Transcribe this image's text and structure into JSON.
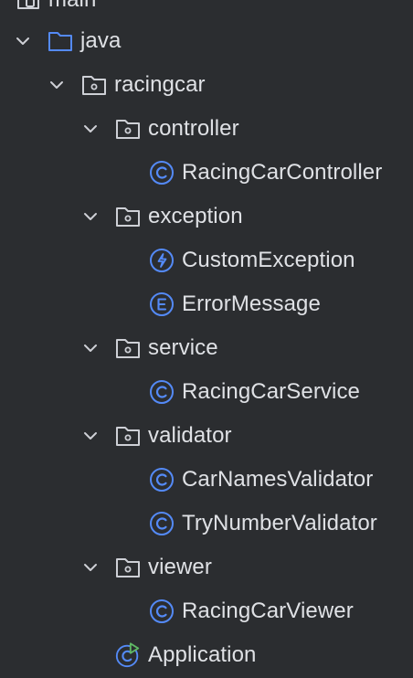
{
  "tree": {
    "rows": [
      {
        "label": "main"
      },
      {
        "label": "java"
      },
      {
        "label": "racingcar"
      },
      {
        "label": "controller"
      },
      {
        "label": "RacingCarController"
      },
      {
        "label": "exception"
      },
      {
        "label": "CustomException"
      },
      {
        "label": "ErrorMessage"
      },
      {
        "label": "service"
      },
      {
        "label": "RacingCarService"
      },
      {
        "label": "validator"
      },
      {
        "label": "CarNamesValidator"
      },
      {
        "label": "TryNumberValidator"
      },
      {
        "label": "viewer"
      },
      {
        "label": "RacingCarViewer"
      },
      {
        "label": "Application"
      }
    ]
  },
  "colors": {
    "background": "#2b2d30",
    "text": "#dfe1e5",
    "folder_blue": "#548af7",
    "package_gray": "#ced0d6",
    "class_icon": "#548af7",
    "run_green": "#5fb865"
  }
}
